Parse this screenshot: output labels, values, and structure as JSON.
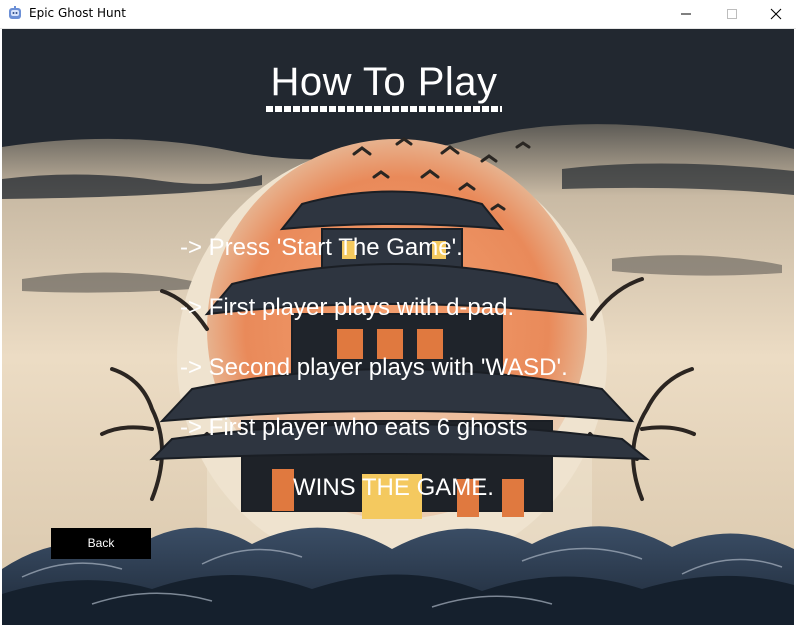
{
  "window": {
    "title": "Epic Ghost Hunt",
    "icons": [
      "app-icon",
      "minimize-icon",
      "maximize-icon",
      "close-icon"
    ]
  },
  "screen": {
    "heading": "How To Play",
    "instructions": [
      "-> Press 'Start The Game'.",
      "-> First player plays with d-pad.",
      "-> Second player plays with 'WASD'.",
      "-> First player who eats 6 ghosts",
      "WINS THE GAME."
    ],
    "back_label": "Back"
  },
  "colors": {
    "text": "#ffffff",
    "button_bg": "#000000",
    "sky": "#e8d9c2",
    "sun": "#e98a5a"
  }
}
